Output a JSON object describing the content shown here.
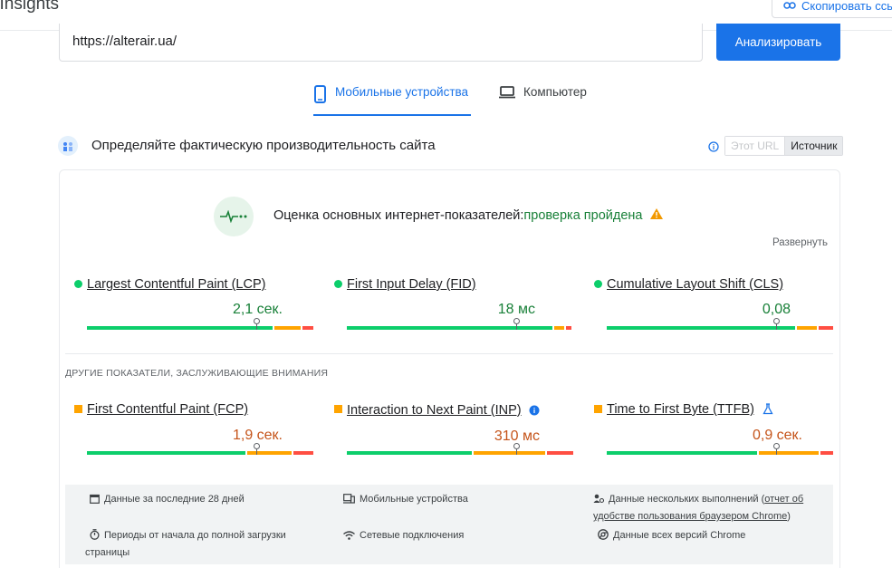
{
  "header": {
    "app_title": "l Insights",
    "copy_button": "Скопировать ссы"
  },
  "url_bar": {
    "value": "https://alterair.ua/",
    "analyze_button": "Анализировать"
  },
  "tabs": {
    "mobile": "Мобильные устройства",
    "desktop": "Компьютер"
  },
  "section": {
    "title": "Определяйте фактическую производительность сайта",
    "toggle_this_url": "Этот URL",
    "toggle_origin": "Источник"
  },
  "assessment": {
    "label": "Оценка основных интернет-показателей:",
    "status": "проверка пройдена",
    "expand": "Развернуть"
  },
  "core_metrics": [
    {
      "name": "Largest Contentful Paint (LCP)",
      "value": "2,1 сек.",
      "status": "good"
    },
    {
      "name": "First Input Delay (FID)",
      "value": "18 мс",
      "status": "good"
    },
    {
      "name": "Cumulative Layout Shift (CLS)",
      "value": "0,08",
      "status": "good"
    }
  ],
  "other_title": "ДРУГИЕ ПОКАЗАТЕЛИ, ЗАСЛУЖИВАЮЩИЕ ВНИМАНИЯ",
  "other_metrics": [
    {
      "name": "First Contentful Paint (FCP)",
      "value": "1,9 сек.",
      "status": "average"
    },
    {
      "name": "Interaction to Next Paint (INP)",
      "value": "310 мс",
      "status": "average"
    },
    {
      "name": "Time to First Byte (TTFB)",
      "value": "0,9 сек.",
      "status": "average"
    }
  ],
  "info": {
    "period": "Данные за последние 28 дней",
    "devices": "Мобильные устройства",
    "multi_pre": "Данные нескольких выполнений (",
    "multi_link_1": "отчет об",
    "multi_link_2": "удобстве пользования браузером Chrome",
    "multi_post": ")",
    "load_1": "Периоды от начала до полной загрузки",
    "load_2": "страницы",
    "network": "Сетевые подключения",
    "chrome": "Данные всех версий Chrome"
  },
  "colors": {
    "accent": "#1a73e8",
    "good": "#0cce6b",
    "average": "#ffa400",
    "poor": "#ff4e42"
  }
}
